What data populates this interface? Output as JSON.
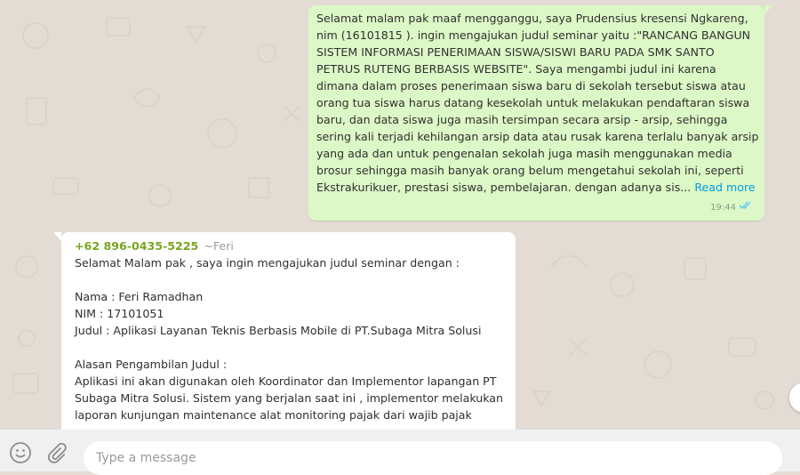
{
  "outgoing": {
    "lines": [
      "Selamat malam pak maaf mengganggu, saya Prudensius kresensi Ngkareng,",
      "nim (16101815 ). ingin mengajukan judul seminar yaitu :\"RANCANG BANGUN",
      "SISTEM INFORMASI PENERIMAAN SISWA/SISWI BARU PADA SMK SANTO",
      "PETRUS RUTENG BERBASIS WEBSITE\". Saya mengambi judul ini karena",
      "dimana dalam proses penerimaan siswa baru di sekolah tersebut siswa atau",
      "orang tua siswa harus datang kesekolah untuk melakukan pendaftaran siswa",
      "baru, dan data siswa juga masih tersimpan secara arsip - arsip, sehingga",
      "sering kali terjadi kehilangan arsip data atau rusak karena terlalu banyak arsip",
      "yang ada dan untuk pengenalan sekolah juga masih menggunakan media",
      "brosur sehingga masih banyak orang belum  mengetahui sekolah ini, seperti",
      "Ekstrakurikuer, prestasi siswa, pembelajaran. dengan adanya sis..."
    ],
    "read_more": "Read more",
    "time": "19:44",
    "status_icon": "double-check-icon"
  },
  "incoming": {
    "sender_phone": "+62 896-0435-5225",
    "sender_name": "~Feri",
    "lines": [
      "Selamat Malam  pak , saya ingin mengajukan judul seminar dengan :",
      "",
      "Nama : Feri Ramadhan",
      "NIM : 17101051",
      "Judul : Aplikasi Layanan Teknis Berbasis Mobile di PT.Subaga Mitra Solusi",
      "",
      "Alasan Pengambilan Judul :",
      "Aplikasi ini akan digunakan oleh Koordinator dan Implementor lapangan PT",
      "Subaga Mitra Solusi. Sistem yang berjalan saat ini , implementor melakukan",
      "laporan kunjungan maintenance alat monitoring pajak dari wajib pajak"
    ]
  },
  "composer": {
    "placeholder": "Type a message",
    "emoji_icon": "emoji-icon",
    "attach_icon": "paperclip-icon"
  },
  "colors": {
    "outgoing_bubble": "#dcf8c6",
    "incoming_bubble": "#ffffff",
    "sender_phone": "#7aa520",
    "read_more": "#039be5",
    "read_ticks": "#4fc3f7",
    "wallpaper": "#e3dcd4"
  }
}
